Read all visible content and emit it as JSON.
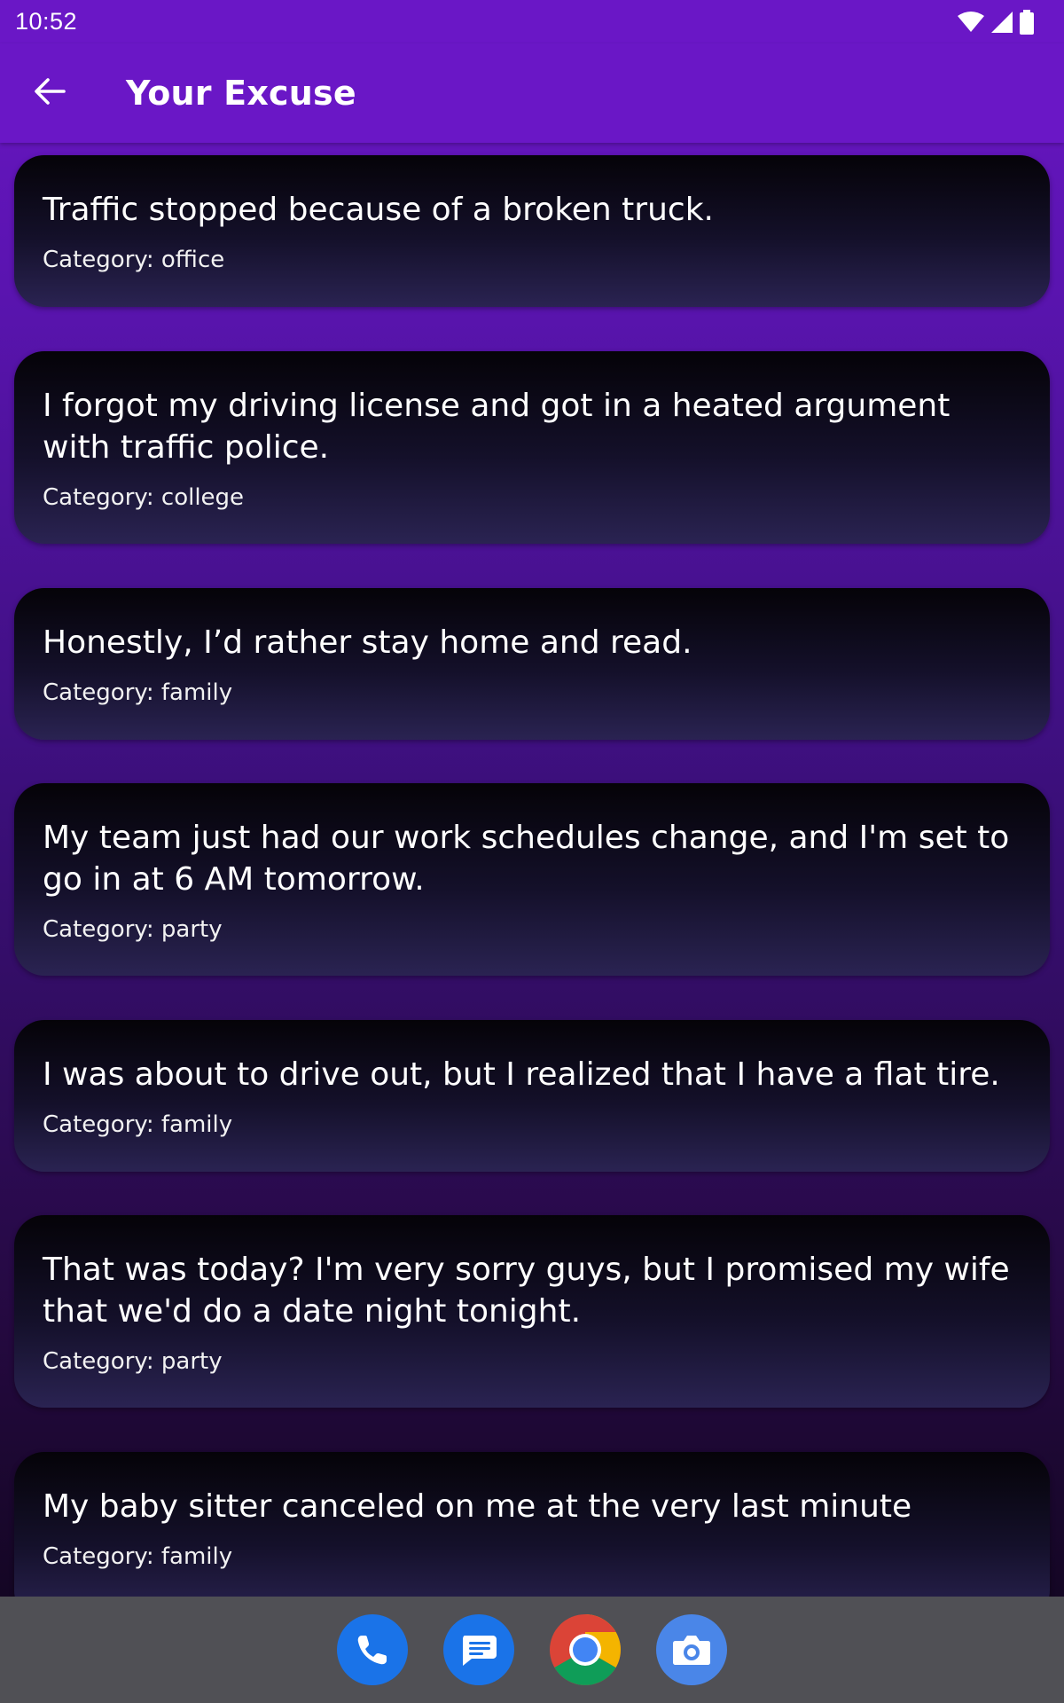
{
  "status_bar": {
    "time": "10:52",
    "icons": [
      "wifi-icon",
      "cell-signal-icon",
      "battery-icon"
    ]
  },
  "app_bar": {
    "title": "Your Excuse",
    "back_icon": "arrow-back-icon"
  },
  "excuses": [
    {
      "text": "Traffic stopped because of a broken truck.",
      "category": "Category: office"
    },
    {
      "text": "I forgot my driving license and got in a heated argument with traffic police.",
      "category": "Category: college"
    },
    {
      "text": "Honestly, I’d rather stay home and read.",
      "category": "Category: family"
    },
    {
      "text": "My team just had our work schedules change, and I'm set to go in at 6 AM tomorrow.",
      "category": "Category: party"
    },
    {
      "text": "I was about to drive out, but I realized that I have a flat tire.",
      "category": "Category: family"
    },
    {
      "text": "That was today? I'm very sorry guys, but I promised my wife that we'd do a date night tonight.",
      "category": "Category: party"
    },
    {
      "text": "My baby sitter canceled on me at the very last minute",
      "category": "Category: family"
    }
  ],
  "dock": [
    "phone-icon",
    "messages-icon",
    "chrome-icon",
    "camera-icon"
  ],
  "colors": {
    "app_bar": "#6a17c6",
    "nav_bar": "#505055",
    "card_top": "#050308",
    "card_bottom": "#2a2352",
    "text": "#ffffff"
  }
}
